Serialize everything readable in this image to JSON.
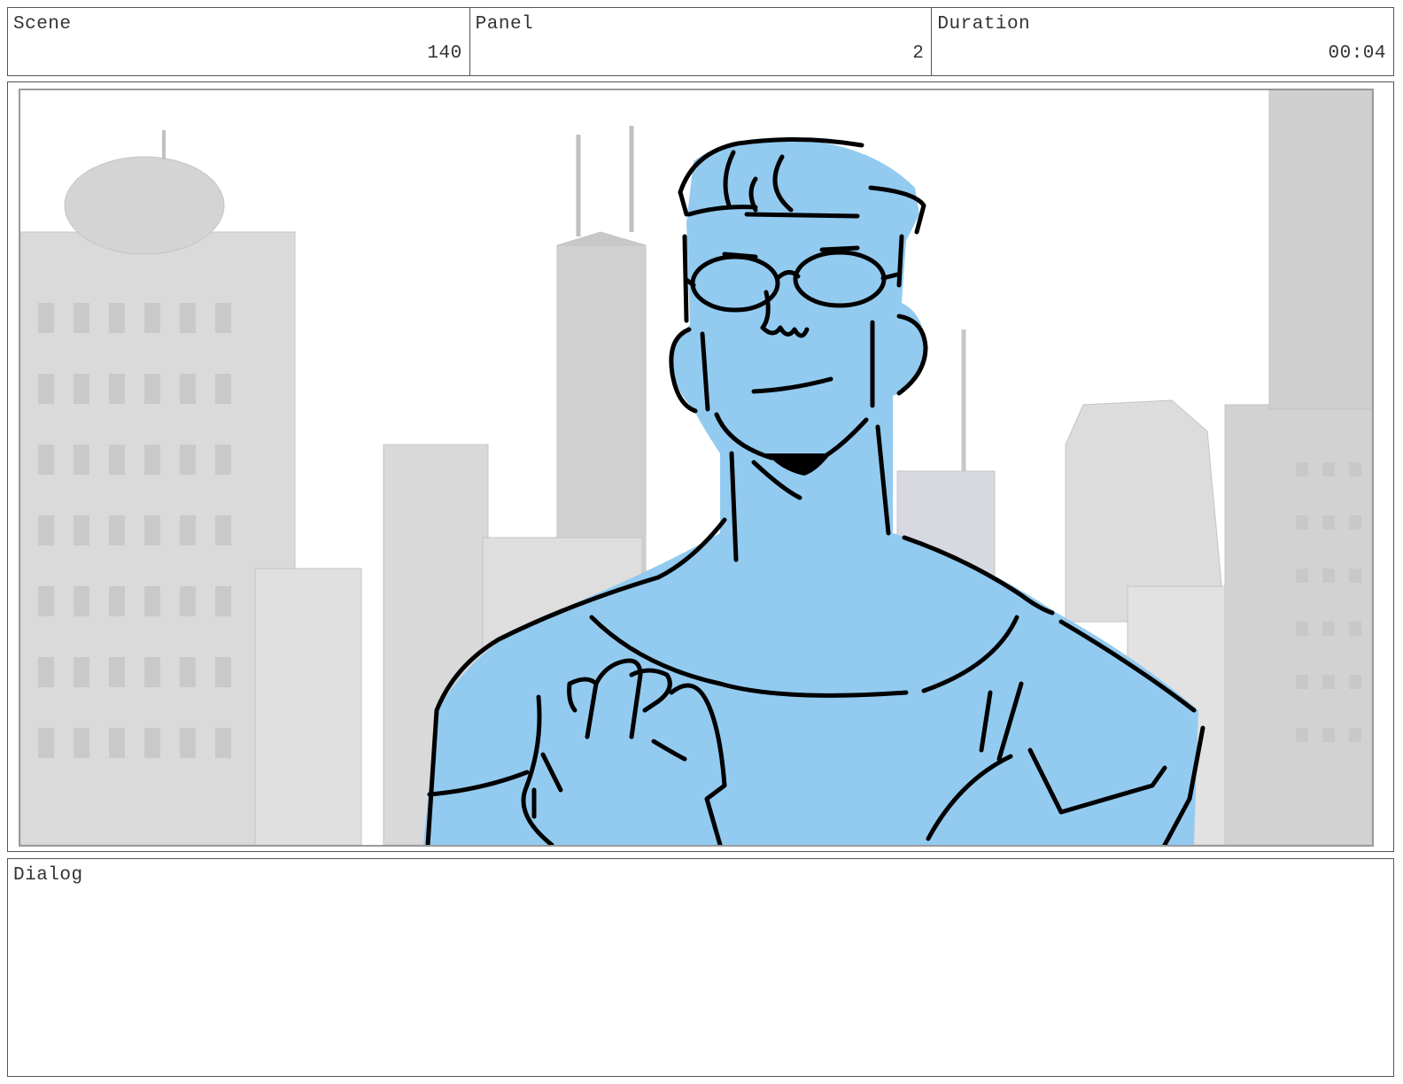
{
  "header": {
    "scene": {
      "label": "Scene",
      "value": "140"
    },
    "panel": {
      "label": "Panel",
      "value": "2"
    },
    "duration": {
      "label": "Duration",
      "value": "00:04"
    }
  },
  "illustration": {
    "figure_fill": "#93cbf0",
    "line_color": "#000000",
    "building_color": "#d3d3d3"
  },
  "dialog": {
    "label": "Dialog",
    "text": ""
  }
}
